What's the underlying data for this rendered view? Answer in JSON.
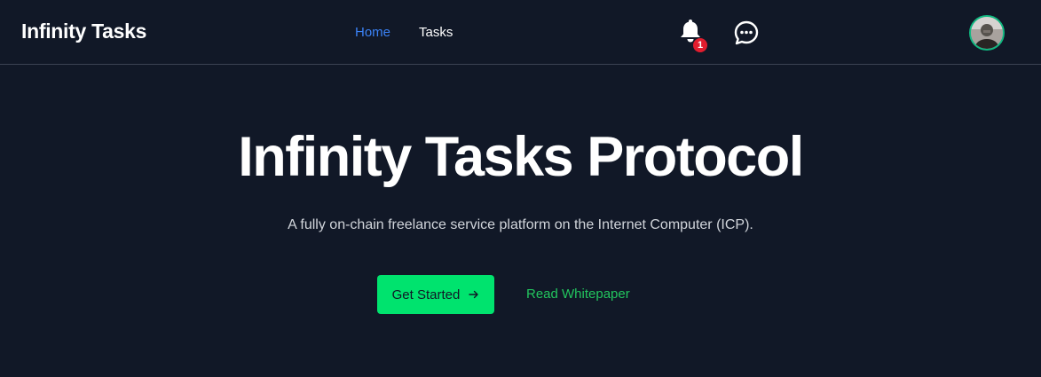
{
  "header": {
    "brand": "Infinity Tasks",
    "nav": {
      "home": "Home",
      "tasks": "Tasks"
    },
    "notifications": {
      "count": "1",
      "icon": "bell-icon"
    },
    "messages": {
      "icon": "chat-bubble-icon"
    },
    "avatar": {
      "icon": "user-avatar"
    }
  },
  "hero": {
    "title": "Infinity Tasks Protocol",
    "subtitle": "A fully on-chain freelance service platform on the Internet Computer (ICP).",
    "primary_cta": "Get Started",
    "primary_cta_icon": "arrow-right-icon",
    "secondary_cta": "Read Whitepaper"
  },
  "colors": {
    "background": "#111827",
    "accent_green": "#00e36e",
    "link_green": "#22c55e",
    "active_link": "#3b82f6",
    "badge_red": "#e11d2e"
  }
}
